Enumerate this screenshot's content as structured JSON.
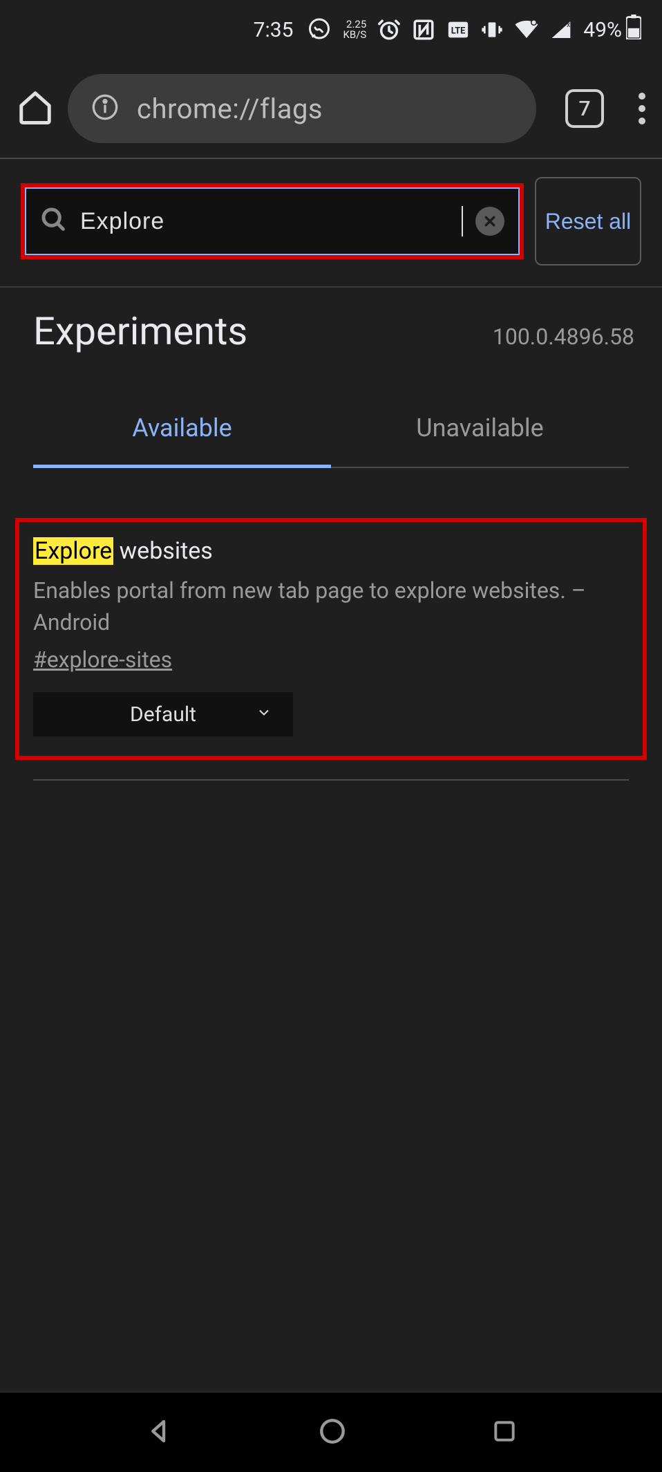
{
  "status": {
    "time": "7:35",
    "kbs_top": "2.25",
    "kbs_bottom": "KB/S",
    "battery_pct": "49%"
  },
  "browser": {
    "url": "chrome://flags",
    "tab_count": "7"
  },
  "flags": {
    "search_value": "Explore",
    "reset_label": "Reset all",
    "title": "Experiments",
    "version": "100.0.4896.58",
    "tab_available": "Available",
    "tab_unavailable": "Unavailable",
    "card": {
      "highlight": "Explore",
      "title_rest": " websites",
      "description": "Enables portal from new tab page to explore websites. – Android",
      "hash": "#explore-sites",
      "select_value": "Default"
    }
  }
}
